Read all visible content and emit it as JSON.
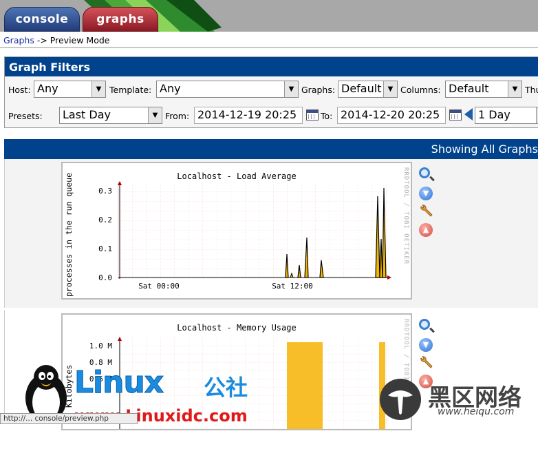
{
  "tabs": {
    "console": "console",
    "graphs": "graphs"
  },
  "breadcrumb": {
    "link": "Graphs",
    "sep": " -> ",
    "current": "Preview Mode"
  },
  "filters": {
    "title": "Graph Filters",
    "host_label": "Host:",
    "host_value": "Any",
    "template_label": "Template:",
    "template_value": "Any",
    "graphs_label": "Graphs:",
    "graphs_value": "Default",
    "columns_label": "Columns:",
    "columns_value": "Default",
    "thumb_label": "Thu",
    "presets_label": "Presets:",
    "presets_value": "Last Day",
    "from_label": "From:",
    "from_value": "2014-12-19 20:25",
    "to_label": "To:",
    "to_value": "2014-12-20 20:25",
    "shift_value": "1 Day"
  },
  "showing": "Showing All Graphs",
  "graphs": [
    {
      "title": "Localhost - Load Average",
      "ylabel": "processes in the run queue",
      "rrd": "RRDTOOL / TOBI OETIKER",
      "yticks": [
        "0.3",
        "0.2",
        "0.1",
        "0.0"
      ],
      "xticks": [
        "Sat 00:00",
        "Sat 12:00"
      ]
    },
    {
      "title": "Localhost - Memory Usage",
      "ylabel": "Kilobytes",
      "rrd": "RRDTOOL / TOBI OETIKER",
      "yticks": [
        "1.0 M",
        "0.8 M",
        "0.6 M"
      ],
      "xticks": []
    }
  ],
  "watermark": {
    "brand": "Linux",
    "brand_cn": "公社",
    "url": "www.Linuxidc.com",
    "heiqu": "黑区网络",
    "heiqu_url": "www.heiqu.com"
  },
  "statusbar": "http://... console/preview.php"
}
